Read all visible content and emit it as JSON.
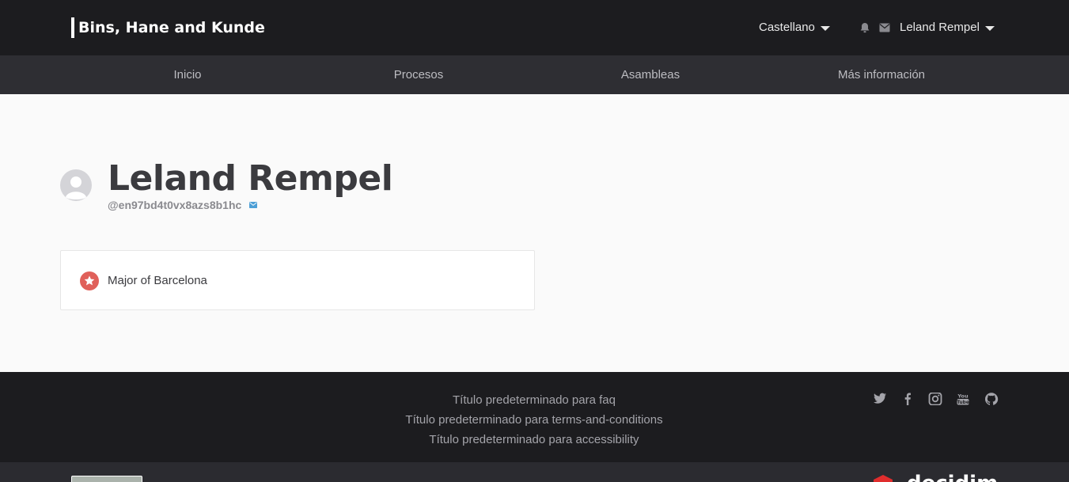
{
  "header": {
    "organization_name": "Bins, Hane and Kunde",
    "language": "Castellano",
    "user_name": "Leland Rempel",
    "icons": {
      "notifications": "bell-icon",
      "conversations": "envelope-icon"
    }
  },
  "nav": {
    "items": [
      {
        "label": "Inicio"
      },
      {
        "label": "Procesos"
      },
      {
        "label": "Asambleas"
      },
      {
        "label": "Más información"
      }
    ]
  },
  "profile": {
    "name": "Leland Rempel",
    "nickname": "@en97bd4t0vx8azs8b1hc",
    "message_icon": "envelope-icon",
    "badge": {
      "label": "Major of Barcelona",
      "icon": "star-icon"
    }
  },
  "footer": {
    "links": [
      {
        "label": "Título predeterminado para faq"
      },
      {
        "label": "Título predeterminado para terms-and-conditions"
      },
      {
        "label": "Título predeterminado para accessibility"
      }
    ],
    "social": [
      "twitter-icon",
      "facebook-icon",
      "instagram-icon",
      "youtube-icon",
      "github-icon"
    ]
  },
  "colors": {
    "header_bg": "#1c1c1f",
    "nav_bg": "#2e2e33",
    "content_bg": "#fafafa",
    "badge_accent": "#e0605a",
    "nickname_msg_icon": "#4d9fd6"
  }
}
